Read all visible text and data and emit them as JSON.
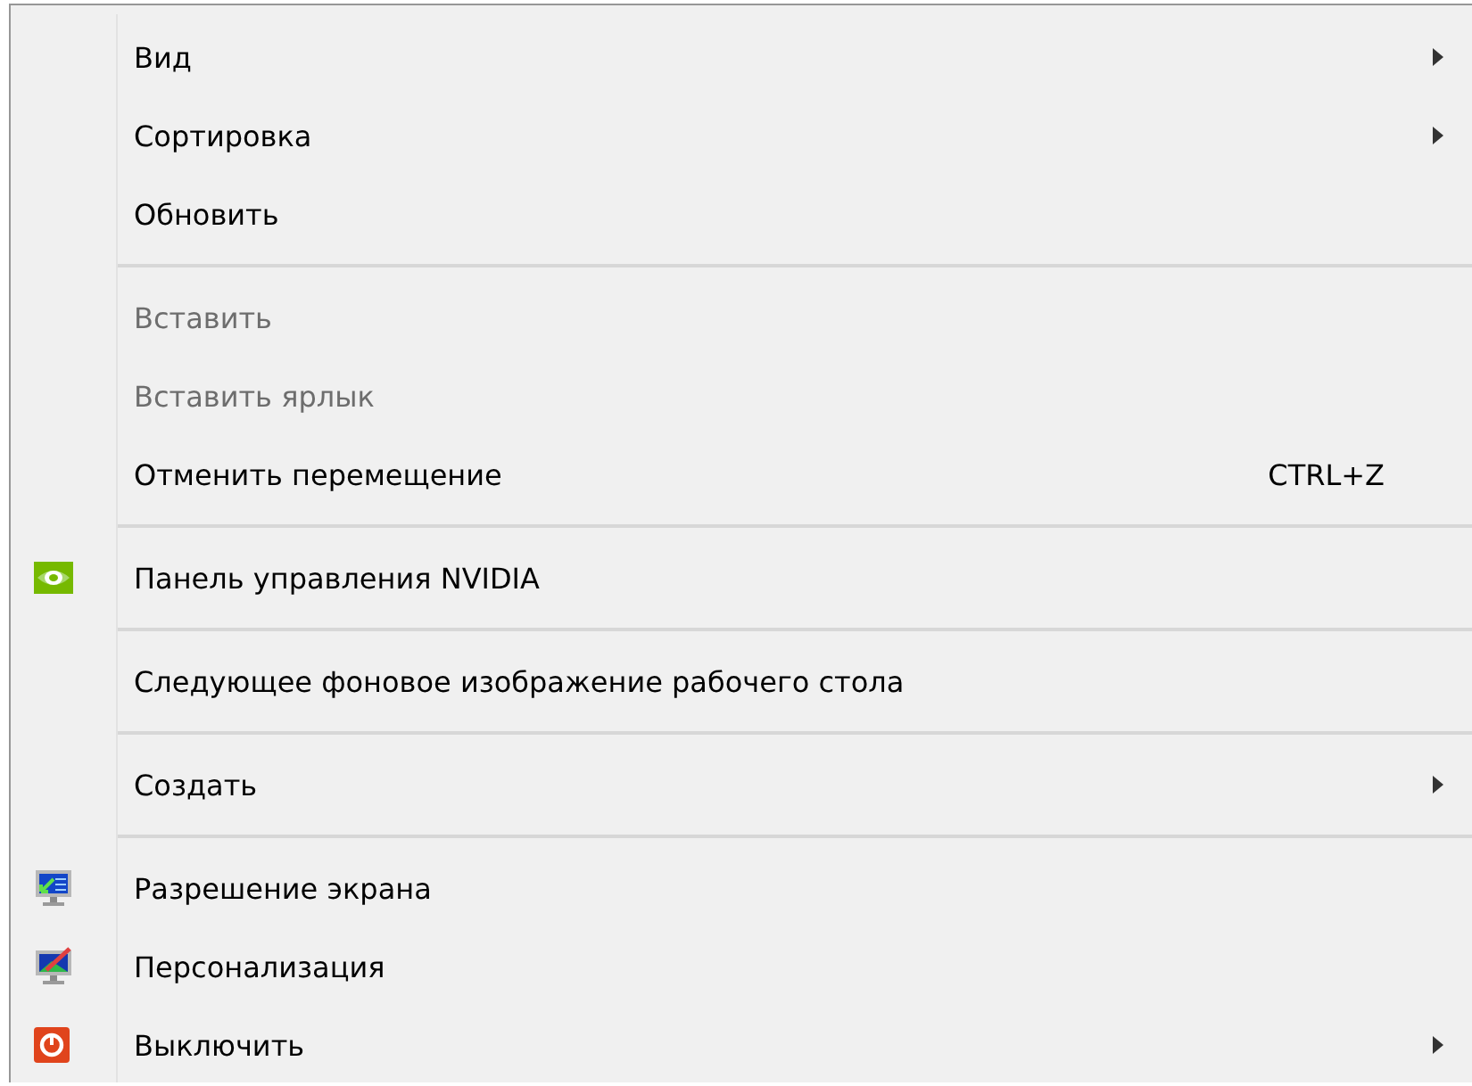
{
  "menu": {
    "entries": [
      {
        "kind": "item",
        "label": "Вид",
        "submenu": true,
        "disabled": false
      },
      {
        "kind": "item",
        "label": "Сортировка",
        "submenu": true,
        "disabled": false
      },
      {
        "kind": "item",
        "label": "Обновить",
        "submenu": false,
        "disabled": false
      },
      {
        "kind": "separator"
      },
      {
        "kind": "item",
        "label": "Вставить",
        "submenu": false,
        "disabled": true
      },
      {
        "kind": "item",
        "label": "Вставить ярлык",
        "submenu": false,
        "disabled": true
      },
      {
        "kind": "item",
        "label": "Отменить перемещение",
        "shortcut": "CTRL+Z",
        "submenu": false,
        "disabled": false
      },
      {
        "kind": "separator"
      },
      {
        "kind": "item",
        "label": "Панель управления NVIDIA",
        "submenu": false,
        "disabled": false
      },
      {
        "kind": "separator"
      },
      {
        "kind": "item",
        "label": "Следующее фоновое изображение рабочего стола",
        "submenu": false,
        "disabled": false
      },
      {
        "kind": "separator"
      },
      {
        "kind": "item",
        "label": "Создать",
        "submenu": true,
        "disabled": false
      },
      {
        "kind": "separator"
      },
      {
        "kind": "item",
        "label": "Разрешение экрана",
        "submenu": false,
        "disabled": false
      },
      {
        "kind": "item",
        "label": "Персонализация",
        "submenu": false,
        "disabled": false
      },
      {
        "kind": "item",
        "label": "Выключить",
        "submenu": true,
        "disabled": false
      }
    ]
  }
}
